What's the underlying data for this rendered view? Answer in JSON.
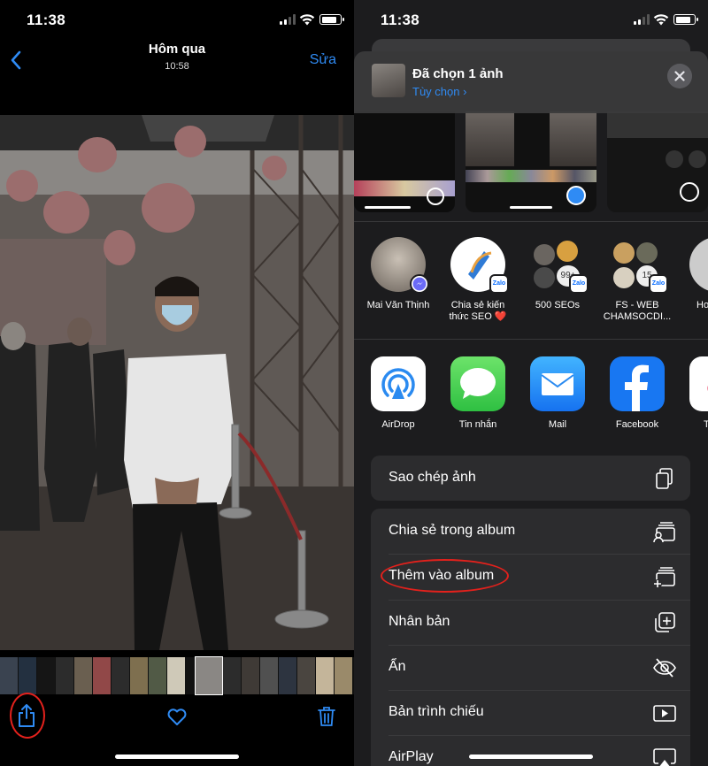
{
  "status_bar": {
    "time": "11:38"
  },
  "left": {
    "nav": {
      "title": "Hôm qua",
      "subtitle": "10:58",
      "edit_label": "Sửa"
    },
    "photo": {
      "description_icon": "photo-content"
    },
    "toolbar": {
      "share_icon": "share-icon",
      "favorite_icon": "heart-icon",
      "delete_icon": "trash-icon"
    }
  },
  "right": {
    "header": {
      "title": "Đã chọn 1 ảnh",
      "options_label": "Tùy chọn ›"
    },
    "contacts": [
      {
        "name_line1": "Mai Văn Thịnh",
        "name_line2": "",
        "badge": "messenger"
      },
      {
        "name_line1": "Chia sẻ kiến",
        "name_line2": "thức SEO ❤️",
        "badge": "zalo"
      },
      {
        "name_line1": "500 SEOs",
        "name_line2": "",
        "badge": "zalo"
      },
      {
        "name_line1": "FS - WEB",
        "name_line2": "CHAMSOCDI...",
        "badge": "zalo"
      },
      {
        "name_line1": "Ho",
        "name_line2": "",
        "badge": ""
      }
    ],
    "apps": [
      {
        "name": "AirDrop",
        "icon": "airdrop-icon"
      },
      {
        "name": "Tin nhắn",
        "icon": "messages-icon"
      },
      {
        "name": "Mail",
        "icon": "mail-icon"
      },
      {
        "name": "Facebook",
        "icon": "facebook-icon"
      },
      {
        "name": "T",
        "icon": "tiktok-icon"
      }
    ],
    "actions_group1": [
      {
        "label": "Sao chép ảnh",
        "icon": "copy-icon"
      }
    ],
    "actions_group2": [
      {
        "label": "Chia sẻ trong album",
        "icon": "shared-album-icon"
      },
      {
        "label": "Thêm vào album",
        "icon": "add-to-album-icon"
      },
      {
        "label": "Nhân bản",
        "icon": "duplicate-icon"
      },
      {
        "label": "Ẩn",
        "icon": "hide-icon"
      },
      {
        "label": "Bản trình chiếu",
        "icon": "slideshow-icon"
      },
      {
        "label": "AirPlay",
        "icon": "airplay-icon"
      }
    ],
    "colors": {
      "accent": "#2f8bf4",
      "highlight": "#e3211c",
      "sheet": "#1c1c1e",
      "row": "#2c2c2e"
    }
  }
}
